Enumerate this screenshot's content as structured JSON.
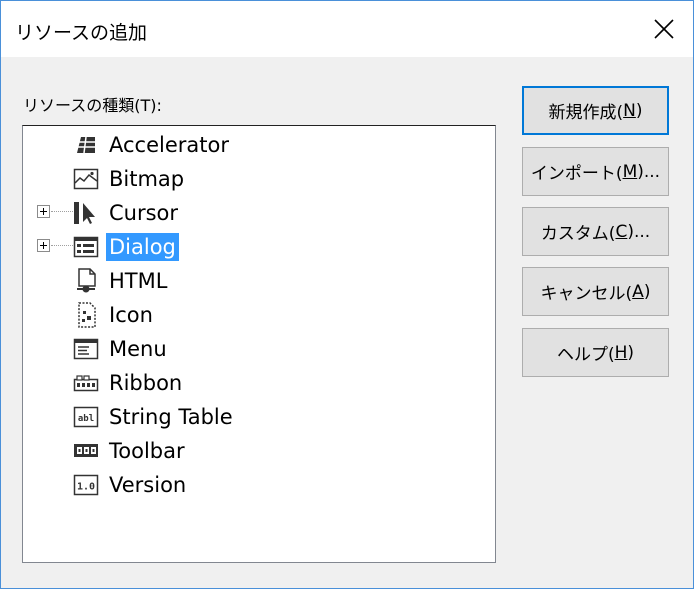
{
  "window": {
    "title": "リソースの追加",
    "close_icon": "close-icon"
  },
  "tree": {
    "label": "リソースの種類(T):",
    "items": [
      {
        "label": "Accelerator",
        "icon": "accelerator-icon",
        "expandable": false,
        "selected": false
      },
      {
        "label": "Bitmap",
        "icon": "bitmap-icon",
        "expandable": false,
        "selected": false
      },
      {
        "label": "Cursor",
        "icon": "cursor-icon",
        "expandable": true,
        "selected": false
      },
      {
        "label": "Dialog",
        "icon": "dialog-icon",
        "expandable": true,
        "selected": true
      },
      {
        "label": "HTML",
        "icon": "html-icon",
        "expandable": false,
        "selected": false
      },
      {
        "label": "Icon",
        "icon": "icon-resource-icon",
        "expandable": false,
        "selected": false
      },
      {
        "label": "Menu",
        "icon": "menu-icon",
        "expandable": false,
        "selected": false
      },
      {
        "label": "Ribbon",
        "icon": "ribbon-icon",
        "expandable": false,
        "selected": false
      },
      {
        "label": "String Table",
        "icon": "string-table-icon",
        "expandable": false,
        "selected": false
      },
      {
        "label": "Toolbar",
        "icon": "toolbar-icon",
        "expandable": false,
        "selected": false
      },
      {
        "label": "Version",
        "icon": "version-icon",
        "expandable": false,
        "selected": false
      }
    ]
  },
  "buttons": {
    "new": {
      "pre": "新規作成(",
      "key": "N",
      "post": ")"
    },
    "import": {
      "pre": "インポート(",
      "key": "M",
      "post": ")..."
    },
    "custom": {
      "pre": "カスタム(",
      "key": "C",
      "post": ")..."
    },
    "cancel": {
      "pre": "キャンセル(",
      "key": "A",
      "post": ")"
    },
    "help": {
      "pre": "ヘルプ(",
      "key": "H",
      "post": ")"
    }
  },
  "colors": {
    "selection": "#3399ff",
    "default_button_border": "#0078d7",
    "window_border": "#4a90d9"
  }
}
